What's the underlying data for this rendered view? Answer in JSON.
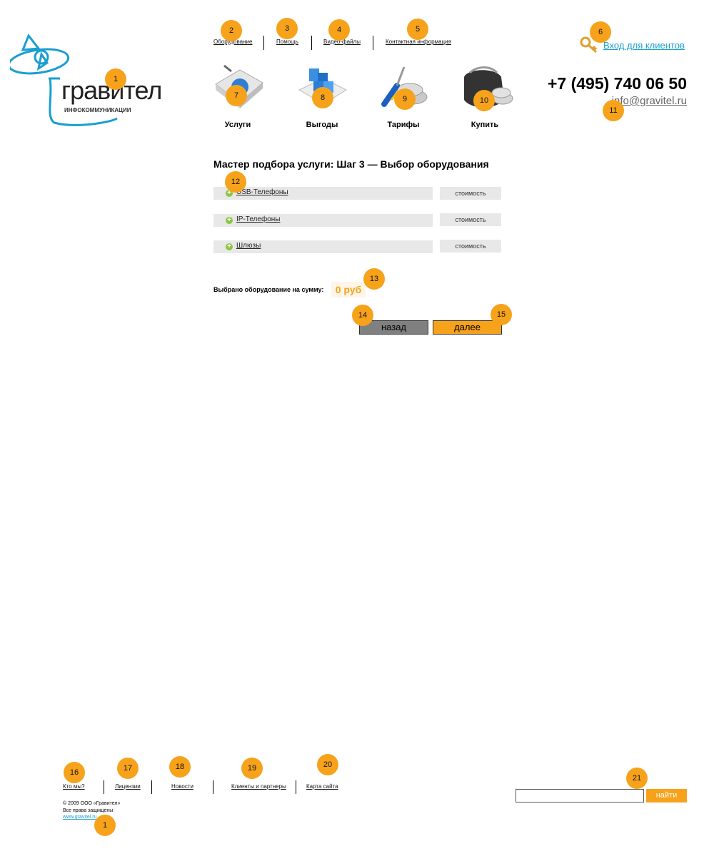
{
  "brand": {
    "name": "гравител",
    "tagline": "ИНФОКОММУНИКАЦИИ"
  },
  "top_nav": [
    {
      "label": "Оборудование"
    },
    {
      "label": "Помощь"
    },
    {
      "label": "Видео-файлы"
    },
    {
      "label": "Контактная информация"
    }
  ],
  "login": {
    "label": "Вход для клиентов"
  },
  "contact": {
    "phone": "+7 (495) 740 06 50",
    "email": "info@gravitel.ru"
  },
  "main_nav": [
    {
      "label": "Услуги",
      "icon": "book-icon"
    },
    {
      "label": "Выгоды",
      "icon": "cubes-icon"
    },
    {
      "label": "Тарифы",
      "icon": "tools-coins-icon"
    },
    {
      "label": "Купить",
      "icon": "wallet-icon"
    }
  ],
  "wizard": {
    "title": "Мастер подбора услуги: Шаг 3 — Выбор оборудования",
    "rows": [
      {
        "label": "USB-Телефоны",
        "cost_label": "стоимость"
      },
      {
        "label": "IP-Телефоны",
        "cost_label": "стоимость"
      },
      {
        "label": "Шлюзы",
        "cost_label": "стоимость"
      }
    ],
    "sum_label": "Выбрано оборудование на сумму:",
    "sum_value": "0 руб",
    "back_label": "назад",
    "next_label": "далее"
  },
  "footer": {
    "links": [
      {
        "label": "Кто мы?"
      },
      {
        "label": "Лицензии"
      },
      {
        "label": "Новости"
      },
      {
        "label": "Клиенты и партнеры"
      },
      {
        "label": "Карта сайта"
      }
    ],
    "copyright": "© 2009 ООО «Гравител»",
    "rights": "Все права защищены",
    "site_link": "www.gravitel.ru",
    "search_placeholder": "",
    "search_button": "найти"
  },
  "markers": [
    "1",
    "2",
    "3",
    "4",
    "5",
    "6",
    "7",
    "8",
    "9",
    "10",
    "11",
    "12",
    "13",
    "14",
    "15",
    "16",
    "17",
    "18",
    "19",
    "20",
    "21",
    "1"
  ],
  "colors": {
    "accent_orange": "#f7a21b",
    "brand_blue": "#1a9ed0",
    "button_gray": "#808080",
    "row_gray": "#e8e8e8",
    "plus_green": "#8cc63f"
  }
}
